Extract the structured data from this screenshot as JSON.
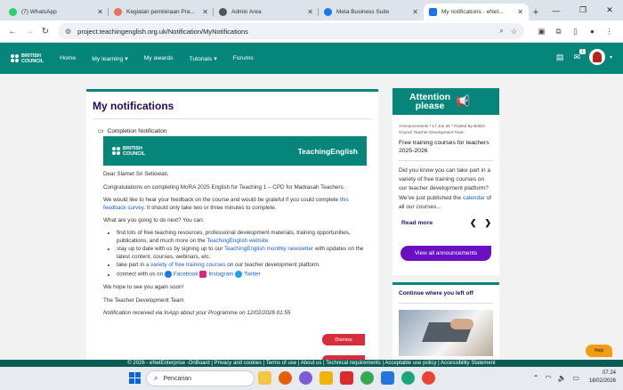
{
  "browser": {
    "tabs": [
      {
        "title": "(7) WhatsApp",
        "color": "#25d366",
        "active": false
      },
      {
        "title": "Kegiatan pembinaan Pra...",
        "color": "#e8735a",
        "active": false
      },
      {
        "title": "Admin Area",
        "color": "#555555",
        "active": false
      },
      {
        "title": "Meta Business Suite",
        "color": "#1877f2",
        "active": false
      },
      {
        "title": "My notifications - eNet...",
        "color": "#1a73e8",
        "active": true
      }
    ],
    "new_tab": "+",
    "window_controls": {
      "minimize": "—",
      "maximize": "❐",
      "close": "✕"
    },
    "url": "project.teachingenglish.org.uk/Notification/MyNotifications"
  },
  "site": {
    "logo_line1": "BRITISH",
    "logo_line2": "COUNCIL",
    "nav": [
      {
        "label": "Home"
      },
      {
        "label": "My learning ▾"
      },
      {
        "label": "My awards"
      },
      {
        "label": "Tutorials ▾"
      },
      {
        "label": "Forums"
      }
    ],
    "message_badge": "1"
  },
  "main": {
    "title": "My notifications",
    "notification_title": "Completion Notification",
    "banner_logo_line1": "BRITISH",
    "banner_logo_line2": "COUNCIL",
    "banner_brand": "TeachingEnglish",
    "greeting": "Dear Slamet Sri Setiowati,",
    "para1": "Congratulations on completing MoRA 2025 English for Teaching 1 – CPD for Madrasah Teachers.",
    "para2_a": "We would like to hear your feedback on the course and would be grateful if you could complete ",
    "para2_link": "this feedback survey",
    "para2_b": ". It should only take two or three minutes to complete.",
    "para3": "What are you going to do next? You can:",
    "li1_a": "find lots of free teaching resources, professional development materials, training opportunities, publications, and much more on the ",
    "li1_link": "TeachingEnglish website",
    "li2_a": "stay up to date with us by signing up to our ",
    "li2_link": "TeachingEnglish monthly newsletter",
    "li2_b": " with updates on the latest content, courses, webinars, etc.",
    "li3_a": "take part in ",
    "li3_link": "a variety of free training courses",
    "li3_b": " on our teacher development platform.",
    "li4_a": "connect with us on ",
    "li4_fb": "Facebook",
    "li4_ig": "Instagram",
    "li4_tw": "Twitter",
    "para4": "We hope to see you again soon!",
    "signoff": "The Teacher Development Team",
    "received": "Notification received via InApp about your Programme on 12/02/2026 01:55",
    "dismiss_label": "Dismiss"
  },
  "attention": {
    "heading_line1": "Attention",
    "heading_line2": "please",
    "meta": "Announcements * 17 Jun 25 * Posted By British Council Teacher Development Team",
    "title": "Free training courses for teachers 2025-2026",
    "body_a": "Did you know you can take part in a variety of free training courses on our teacher development platform?  We've just published the ",
    "body_link": "calendar",
    "body_b": " of all our courses...",
    "read_more": "Read more",
    "prev": "❮",
    "next": "❯",
    "view_all": "View all announcements"
  },
  "continue": {
    "title": "Continue where you left off"
  },
  "help_label": "Help",
  "footer": "© 2026 - eNetEnterprise -OnBoard | Privacy and cookies | Terms of use | About us | Technical requirements | Acceptable use policy | Accessibility Statement",
  "taskbar": {
    "search_placeholder": "Pencarian",
    "apps": [
      {
        "name": "file-explorer",
        "color": "#f4c542"
      },
      {
        "name": "firefox",
        "color": "#e66000"
      },
      {
        "name": "copilot",
        "color": "#7b5cd6"
      },
      {
        "name": "folder",
        "color": "#f0b400"
      },
      {
        "name": "wps",
        "color": "#d92b2b"
      },
      {
        "name": "chrome",
        "color": "#34a853"
      },
      {
        "name": "store",
        "color": "#2277dd"
      },
      {
        "name": "edge",
        "color": "#1aa57a"
      },
      {
        "name": "chrome-profile",
        "color": "#ea4335"
      }
    ],
    "time": "07.24",
    "date": "18/02/2026"
  }
}
